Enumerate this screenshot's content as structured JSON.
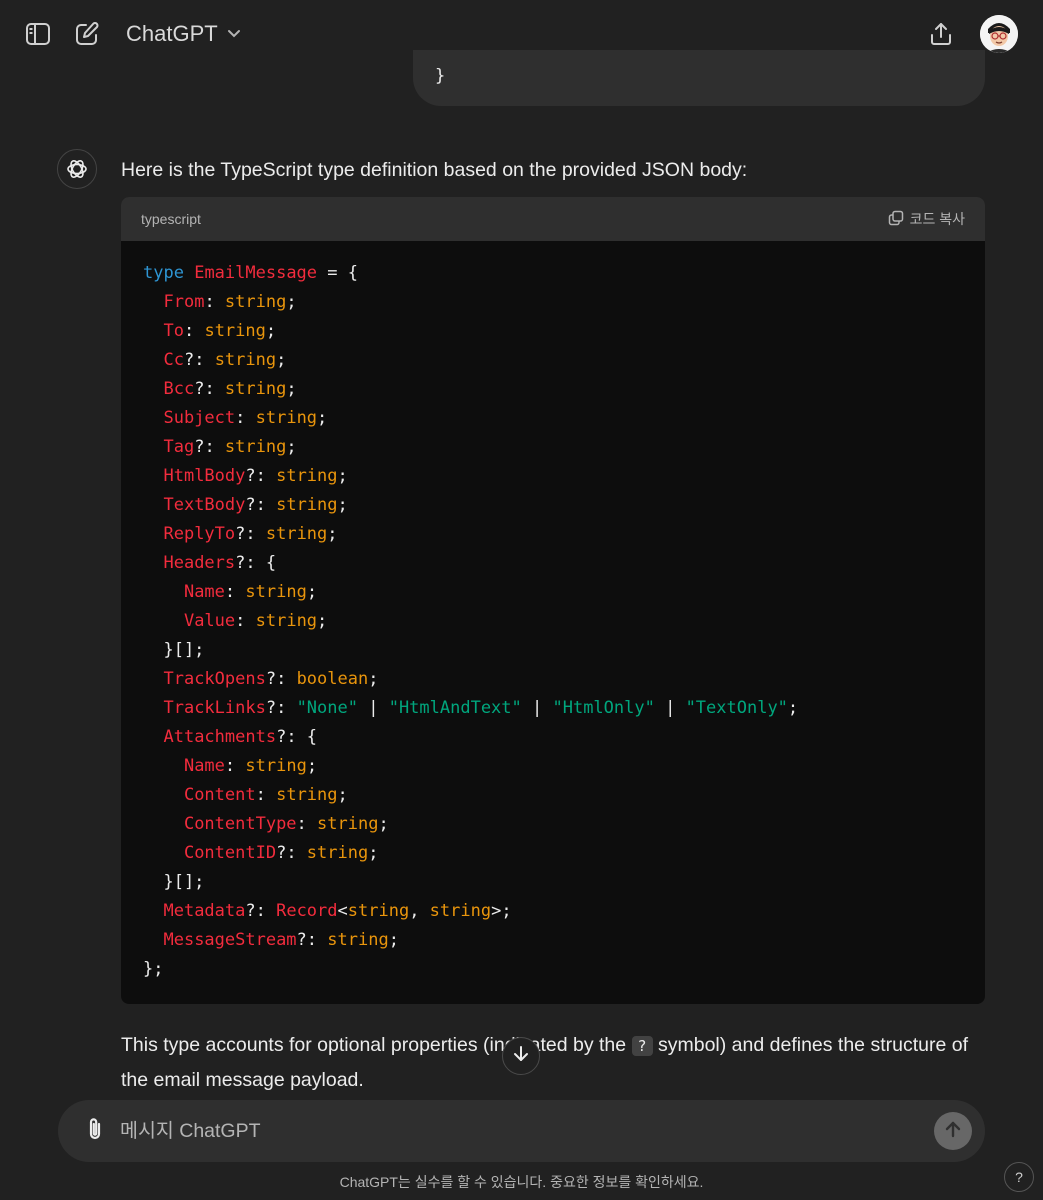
{
  "header": {
    "model_name": "ChatGPT",
    "icons": {
      "sidebar": "sidebar-toggle-icon",
      "new_chat": "new-chat-icon",
      "share": "share-icon",
      "model_dropdown": "chevron-down-icon"
    }
  },
  "user_message": {
    "visible_tail": "}"
  },
  "assistant": {
    "intro": "Here is the TypeScript type definition based on the provided JSON body:",
    "code": {
      "language": "typescript",
      "copy_label": "코드 복사",
      "lines": [
        [
          [
            "kw",
            "type"
          ],
          [
            "pn",
            " "
          ],
          [
            "ty",
            "EmailMessage"
          ],
          [
            "pn",
            " = {"
          ]
        ],
        [
          [
            "pn",
            "  "
          ],
          [
            "ty",
            "From"
          ],
          [
            "pn",
            ": "
          ],
          [
            "st",
            "string"
          ],
          [
            "pn",
            ";"
          ]
        ],
        [
          [
            "pn",
            "  "
          ],
          [
            "ty",
            "To"
          ],
          [
            "pn",
            ": "
          ],
          [
            "st",
            "string"
          ],
          [
            "pn",
            ";"
          ]
        ],
        [
          [
            "pn",
            "  "
          ],
          [
            "ty",
            "Cc"
          ],
          [
            "pn",
            "?: "
          ],
          [
            "st",
            "string"
          ],
          [
            "pn",
            ";"
          ]
        ],
        [
          [
            "pn",
            "  "
          ],
          [
            "ty",
            "Bcc"
          ],
          [
            "pn",
            "?: "
          ],
          [
            "st",
            "string"
          ],
          [
            "pn",
            ";"
          ]
        ],
        [
          [
            "pn",
            "  "
          ],
          [
            "ty",
            "Subject"
          ],
          [
            "pn",
            ": "
          ],
          [
            "st",
            "string"
          ],
          [
            "pn",
            ";"
          ]
        ],
        [
          [
            "pn",
            "  "
          ],
          [
            "ty",
            "Tag"
          ],
          [
            "pn",
            "?: "
          ],
          [
            "st",
            "string"
          ],
          [
            "pn",
            ";"
          ]
        ],
        [
          [
            "pn",
            "  "
          ],
          [
            "ty",
            "HtmlBody"
          ],
          [
            "pn",
            "?: "
          ],
          [
            "st",
            "string"
          ],
          [
            "pn",
            ";"
          ]
        ],
        [
          [
            "pn",
            "  "
          ],
          [
            "ty",
            "TextBody"
          ],
          [
            "pn",
            "?: "
          ],
          [
            "st",
            "string"
          ],
          [
            "pn",
            ";"
          ]
        ],
        [
          [
            "pn",
            "  "
          ],
          [
            "ty",
            "ReplyTo"
          ],
          [
            "pn",
            "?: "
          ],
          [
            "st",
            "string"
          ],
          [
            "pn",
            ";"
          ]
        ],
        [
          [
            "pn",
            "  "
          ],
          [
            "ty",
            "Headers"
          ],
          [
            "pn",
            "?: {"
          ]
        ],
        [
          [
            "pn",
            "    "
          ],
          [
            "ty",
            "Name"
          ],
          [
            "pn",
            ": "
          ],
          [
            "st",
            "string"
          ],
          [
            "pn",
            ";"
          ]
        ],
        [
          [
            "pn",
            "    "
          ],
          [
            "ty",
            "Value"
          ],
          [
            "pn",
            ": "
          ],
          [
            "st",
            "string"
          ],
          [
            "pn",
            ";"
          ]
        ],
        [
          [
            "pn",
            "  }[];"
          ]
        ],
        [
          [
            "pn",
            "  "
          ],
          [
            "ty",
            "TrackOpens"
          ],
          [
            "pn",
            "?: "
          ],
          [
            "st",
            "boolean"
          ],
          [
            "pn",
            ";"
          ]
        ],
        [
          [
            "pn",
            "  "
          ],
          [
            "ty",
            "TrackLinks"
          ],
          [
            "pn",
            "?: "
          ],
          [
            "str",
            "\"None\""
          ],
          [
            "pn",
            " | "
          ],
          [
            "str",
            "\"HtmlAndText\""
          ],
          [
            "pn",
            " | "
          ],
          [
            "str",
            "\"HtmlOnly\""
          ],
          [
            "pn",
            " | "
          ],
          [
            "str",
            "\"TextOnly\""
          ],
          [
            "pn",
            ";"
          ]
        ],
        [
          [
            "pn",
            "  "
          ],
          [
            "ty",
            "Attachments"
          ],
          [
            "pn",
            "?: {"
          ]
        ],
        [
          [
            "pn",
            "    "
          ],
          [
            "ty",
            "Name"
          ],
          [
            "pn",
            ": "
          ],
          [
            "st",
            "string"
          ],
          [
            "pn",
            ";"
          ]
        ],
        [
          [
            "pn",
            "    "
          ],
          [
            "ty",
            "Content"
          ],
          [
            "pn",
            ": "
          ],
          [
            "st",
            "string"
          ],
          [
            "pn",
            ";"
          ]
        ],
        [
          [
            "pn",
            "    "
          ],
          [
            "ty",
            "ContentType"
          ],
          [
            "pn",
            ": "
          ],
          [
            "st",
            "string"
          ],
          [
            "pn",
            ";"
          ]
        ],
        [
          [
            "pn",
            "    "
          ],
          [
            "ty",
            "ContentID"
          ],
          [
            "pn",
            "?: "
          ],
          [
            "st",
            "string"
          ],
          [
            "pn",
            ";"
          ]
        ],
        [
          [
            "pn",
            "  }[];"
          ]
        ],
        [
          [
            "pn",
            "  "
          ],
          [
            "ty",
            "Metadata"
          ],
          [
            "pn",
            "?: "
          ],
          [
            "ty",
            "Record"
          ],
          [
            "pn",
            "<"
          ],
          [
            "st",
            "string"
          ],
          [
            "pn",
            ", "
          ],
          [
            "st",
            "string"
          ],
          [
            "pn",
            ">;"
          ]
        ],
        [
          [
            "pn",
            "  "
          ],
          [
            "ty",
            "MessageStream"
          ],
          [
            "pn",
            "?: "
          ],
          [
            "st",
            "string"
          ],
          [
            "pn",
            ";"
          ]
        ],
        [
          [
            "pn",
            "};"
          ]
        ]
      ]
    },
    "outro_before": "This type accounts for optional properties (indicated by the ",
    "outro_code": "?",
    "outro_after": " symbol) and defines the structure of the email message payload."
  },
  "composer": {
    "placeholder": "메시지 ChatGPT"
  },
  "footer": {
    "disclaimer": "ChatGPT는 실수를 할 수 있습니다. 중요한 정보를 확인하세요.",
    "help_label": "?"
  },
  "colors": {
    "background": "#212121",
    "code_keyword": "#2e95d3",
    "code_type": "#f22c3d",
    "code_builtin": "#e9950c",
    "code_string": "#00a67d"
  }
}
